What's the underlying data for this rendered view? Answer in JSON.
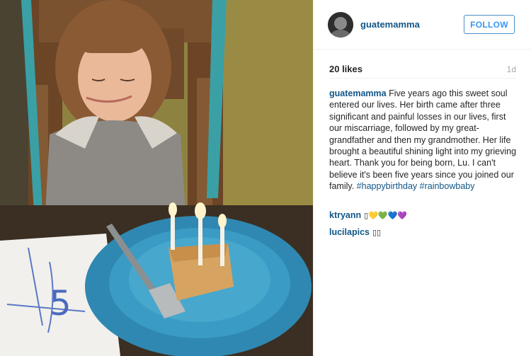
{
  "post": {
    "username": "guatemamma",
    "follow_label": "FOLLOW",
    "likes": "20 likes",
    "age": "1d",
    "caption_user": "guatemamma",
    "caption_text": "Five years ago this sweet soul entered our lives. Her birth came after three significant and painful losses in our lives, first our miscarriage, followed by my great-grandfather and then my grandmother. Her life brought a beautiful shining light into my grieving heart. Thank you for being born, Lu. I can't believe it's been five years since you joined our family.",
    "hashtag_1": "#happybirthday",
    "hashtag_2": "#rainbowbaby"
  },
  "comments": [
    {
      "user": "ktryann",
      "text": "▯💛💚💙💜"
    },
    {
      "user": "lucilapics",
      "text": "▯▯"
    }
  ],
  "photo": {
    "cake_number": "5",
    "colors": {
      "plate": "#3a9bc4",
      "wall": "#8a7b3a",
      "chair": "#6e4a2a",
      "ribbon": "#3aa0a6",
      "napkin": "#f1f0ec"
    }
  }
}
